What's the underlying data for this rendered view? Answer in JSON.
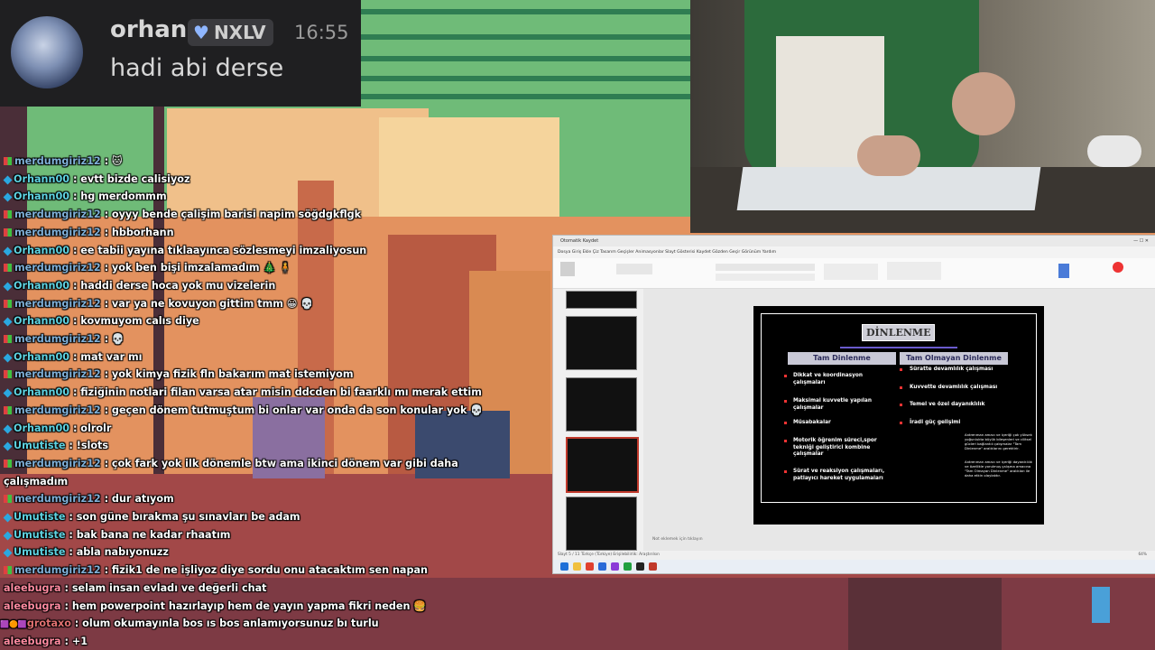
{
  "notification": {
    "username": "orhan",
    "badge": "NXLV",
    "time": "16:55",
    "message": "hadi abi derse"
  },
  "chat": [
    {
      "icon": "grid",
      "user": "merdumgiriz12",
      "cls": "u1",
      "text": " : 🐱"
    },
    {
      "icon": "diamond",
      "user": "Orhann00",
      "cls": "u2",
      "text": " : evtt bizde calisiyoz"
    },
    {
      "icon": "diamond",
      "user": "Orhann00",
      "cls": "u2",
      "text": " : hg merdommm"
    },
    {
      "icon": "grid",
      "user": "merdumgiriz12",
      "cls": "u1",
      "text": " : oyyy bende çalişim barisi napim söğdgkflgk"
    },
    {
      "icon": "grid",
      "user": "merdumgiriz12",
      "cls": "u1",
      "text": " : hbborhann"
    },
    {
      "icon": "diamond",
      "user": "Orhann00",
      "cls": "u2",
      "text": " : ee tabii yayına tıklaayınca sözlesmeyi imzaliyosun"
    },
    {
      "icon": "grid",
      "user": "merdumgiriz12",
      "cls": "u1",
      "text": " : yok ben bişi imzalamadım 🎄 🧍"
    },
    {
      "icon": "diamond",
      "user": "Orhann00",
      "cls": "u2",
      "text": " : haddi derse hoca yok mu vizelerin"
    },
    {
      "icon": "grid",
      "user": "merdumgiriz12",
      "cls": "u1",
      "text": " : var ya ne kovuyon gittim tmm 😀 💀"
    },
    {
      "icon": "diamond",
      "user": "Orhann00",
      "cls": "u2",
      "text": " : kovmuyom calıs diye"
    },
    {
      "icon": "grid",
      "user": "merdumgiriz12",
      "cls": "u1",
      "text": " : 💀"
    },
    {
      "icon": "diamond",
      "user": "Orhann00",
      "cls": "u2",
      "text": " : mat var mı"
    },
    {
      "icon": "grid",
      "user": "merdumgiriz12",
      "cls": "u1",
      "text": " : yok kimya fizik fln bakarım mat istemiyom"
    },
    {
      "icon": "diamond",
      "user": "Orhann00",
      "cls": "u2",
      "text": " : fiziğinin notlari filan varsa atar misin ddcden bi faarklı mı merak ettim"
    },
    {
      "icon": "grid",
      "user": "merdumgiriz12",
      "cls": "u1",
      "text": " : geçen dönem tutmuştum bi onlar var onda da son konular yok 💀"
    },
    {
      "icon": "diamond",
      "user": "Orhann00",
      "cls": "u2",
      "text": " : olrolr"
    },
    {
      "icon": "diamond",
      "user": "Umutiste",
      "cls": "u2",
      "text": " : !slots"
    },
    {
      "icon": "grid",
      "user": "merdumgiriz12",
      "cls": "u1",
      "text": " : çok fark yok ilk dönemle btw ama ikinci dönem var gibi daha"
    },
    {
      "icon": "none",
      "user": "",
      "cls": "u1",
      "text": "çalışmadım"
    },
    {
      "icon": "grid",
      "user": "merdumgiriz12",
      "cls": "u1",
      "text": " : dur atıyom"
    },
    {
      "icon": "diamond",
      "user": "Umutiste",
      "cls": "u2",
      "text": " : son güne bırakma şu sınavları be adam"
    },
    {
      "icon": "diamond",
      "user": "Umutiste",
      "cls": "u2",
      "text": " : bak bana ne kadar rhaatım"
    },
    {
      "icon": "diamond",
      "user": "Umutiste",
      "cls": "u2",
      "text": " : abla nabıyonuzz"
    },
    {
      "icon": "grid",
      "user": "merdumgiriz12",
      "cls": "u1",
      "text": " : fizik1 de ne işliyoz diye sordu onu atacaktım sen napan"
    },
    {
      "icon": "none",
      "user": "aleebugra",
      "cls": "u3",
      "text": " : selam insan evladı ve değerli chat"
    },
    {
      "icon": "none",
      "user": "aleebugra",
      "cls": "u3",
      "text": " : hem powerpoint hazırlayıp hem de yayın yapma fikri neden 🍔"
    },
    {
      "icon": "badges",
      "user": "grotaxo",
      "cls": "u4",
      "text": " : olum okumayınla bos ıs bos anlamıyorsunuz bı turlu"
    },
    {
      "icon": "none",
      "user": "aleebugra",
      "cls": "u3",
      "text": " : +1"
    }
  ],
  "ppt": {
    "app_title": "Dosya    Giriş    Ekle    Çiz    Tasarım    Geçişler    Animasyonlar    Slayt Gösterisi    Kaydet    Gözden Geçir    Görünüm    Yardım",
    "window_title": "Otomatik Kaydet",
    "notes_placeholder": "Not eklemek için tıklayın",
    "status": "Slayt 5 / 11    Türkçe (Türkiye)    Erişilebilirlik: Araştırılsın",
    "zoom": "64%",
    "slide": {
      "title": "DİNLENME",
      "left_header": "Tam Dinlenme",
      "right_header": "Tam Olmayan Dinlenme",
      "left_items": [
        "Dikkat ve koordinasyon çalışmaları",
        "Maksimal kuvvetle yapılan çalışmalar",
        "Müsabakalar",
        "Motorik öğrenim süreci,spor tekniği geliştirici kombine çalışmalar",
        "Sürat ve reaksiyon çalışmaları, patlayıcı hareket uygulamaları"
      ],
      "right_items": [
        "Süratte devamlılık çalışması",
        "Kuvvette devamlılık çalışması",
        "Temel ve özel dayanıklılık",
        "İradi güç gelişimi"
      ],
      "note1": "Antrenman amacı ve içeriği çok yüksek yoğunlukta büyük bileşenleri ve cilitsel gücleri bağlantılı çalışmalar \"Tam Dinlenme\" aralıklarını gerektirir.",
      "note2": "Antrenman amacı ve içeriği dayanıklılık ve özellikle yorulmuş çalışma amacına \"Tam Olmayan Dinlenme\" aralıkları ile daha etkin olaylaktır."
    }
  },
  "colors": {
    "accent": "#c0392b",
    "chat_user1": "#7fb0d8",
    "chat_user2": "#5ed2e0"
  }
}
